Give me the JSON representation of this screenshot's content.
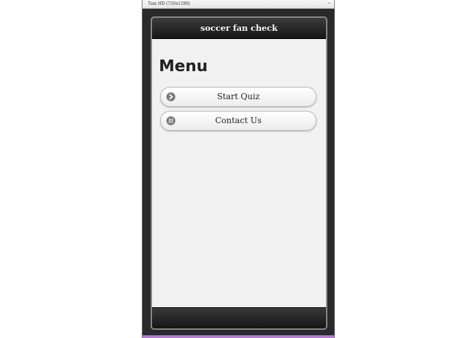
{
  "window": {
    "title": "Tam HD (720x1280)",
    "minimize_label": "–"
  },
  "app": {
    "header_title": "soccer fan check",
    "page_heading": "Menu",
    "buttons": [
      {
        "label": "Start Quiz",
        "icon": "arrow-right-circle-icon"
      },
      {
        "label": "Contact Us",
        "icon": "grid-icon"
      }
    ]
  },
  "colors": {
    "header_bg": "#1e1e1e",
    "content_bg": "#f1f1f1",
    "accent_bottom": "#b47dd0"
  }
}
